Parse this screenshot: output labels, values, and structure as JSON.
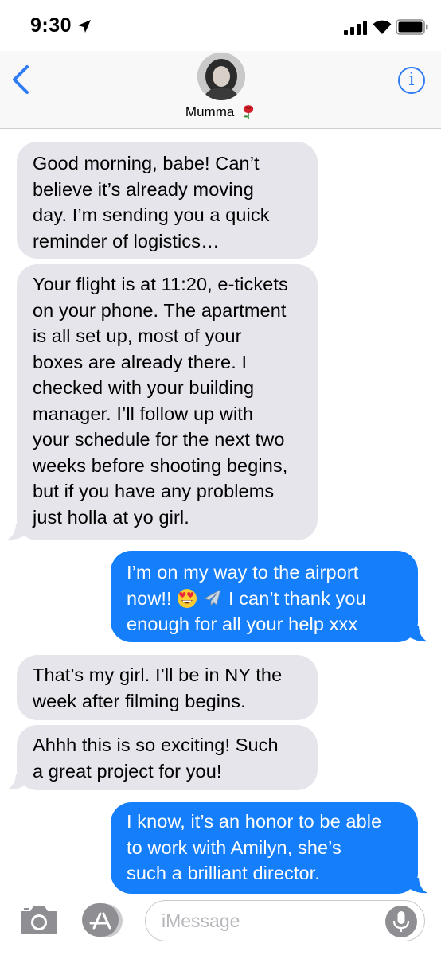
{
  "status_bar": {
    "time": "9:30",
    "icons": [
      "location-arrow-icon",
      "signal-icon",
      "wifi-icon",
      "battery-icon"
    ]
  },
  "header": {
    "contact_name": "Mumma",
    "contact_emoji": "rose-icon",
    "back_icon": "chevron-left-icon",
    "info_icon": "info-icon",
    "info_glyph": "i"
  },
  "messages": [
    {
      "direction": "incoming",
      "text": "Good morning, babe! Can’t\nbelieve it’s already moving\nday. I’m sending you a quick\nreminder of logistics…"
    },
    {
      "direction": "incoming",
      "text": "Your flight is at 11:20, e-tickets\non your phone. The apartment\nis all set up, most of your\nboxes are already there. I\nchecked with your building\nmanager. I’ll follow up with\nyour schedule for the next two\nweeks before shooting begins,\nbut if you have any problems\njust holla at yo girl."
    },
    {
      "direction": "outgoing",
      "text_line1": "I’m on my way to the airport",
      "text_line2_before": "now!! ",
      "emojis": [
        "heart-eyes-emoji",
        "airplane-emoji"
      ],
      "text_line2_after": " I can’t thank you",
      "text_line3": "enough for all your help xxx"
    },
    {
      "direction": "incoming",
      "text": "That’s my girl. I’ll be in NY the\nweek after filming begins."
    },
    {
      "direction": "incoming",
      "text": "Ahhh this is so exciting! Such\na great project for you!"
    },
    {
      "direction": "outgoing",
      "text": "I know, it’s an honor to be able\nto work with Amilyn, she’s\nsuch a brilliant director."
    }
  ],
  "input_bar": {
    "placeholder": "iMessage",
    "icons": [
      "camera-icon",
      "app-store-icon",
      "microphone-icon"
    ]
  },
  "colors": {
    "accent": "#2f7cf6",
    "outgoing_bubble": "#147efb",
    "incoming_bubble": "#e6e5eb",
    "header_bg": "#f8f8f8"
  }
}
